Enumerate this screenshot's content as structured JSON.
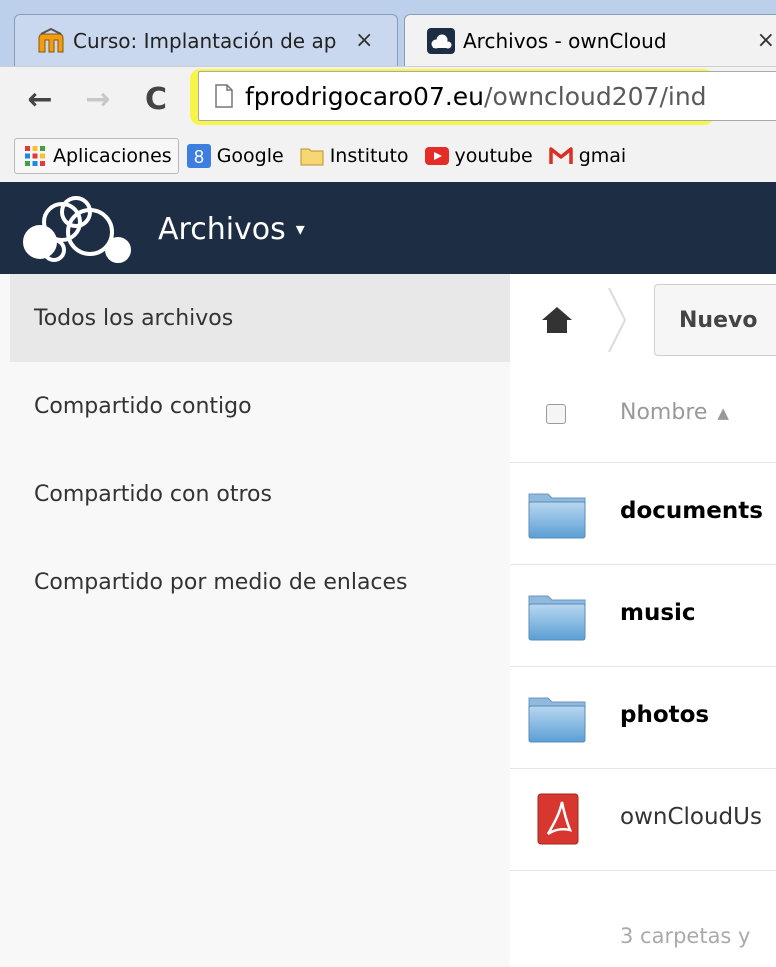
{
  "browser": {
    "tabs": [
      {
        "title": "Curso: Implantación de ap",
        "favicon": "moodle-icon",
        "active": false
      },
      {
        "title": "Archivos - ownCloud",
        "favicon": "owncloud-icon",
        "active": true
      }
    ],
    "tab_close_glyph": "×",
    "nav": {
      "back_glyph": "←",
      "forward_glyph": "→",
      "reload_glyph": "C"
    },
    "url": {
      "domain": "fprodrigocaro07.eu",
      "path": "/owncloud207/ind"
    },
    "highlight_color": "#f7f53b",
    "bookmarks": [
      {
        "label": "Aplicaciones",
        "icon": "apps-grid-icon"
      },
      {
        "label": "Google",
        "icon": "google-plus-icon"
      },
      {
        "label": "Instituto",
        "icon": "folder-icon"
      },
      {
        "label": "youtube",
        "icon": "youtube-icon"
      },
      {
        "label": "gmai",
        "icon": "gmail-icon"
      }
    ]
  },
  "header": {
    "app_name": "Archivos",
    "caret": "▾",
    "background": "#1d2d44"
  },
  "sidebar": {
    "items": [
      {
        "label": "Todos los archivos",
        "active": true
      },
      {
        "label": "Compartido contigo",
        "active": false
      },
      {
        "label": "Compartido con otros",
        "active": false
      },
      {
        "label": "Compartido por medio de enlaces",
        "active": false
      }
    ]
  },
  "main": {
    "new_button": "Nuevo",
    "column_name": "Nombre",
    "sort_glyph": "▲",
    "files": [
      {
        "name": "documents",
        "type": "folder"
      },
      {
        "name": "music",
        "type": "folder"
      },
      {
        "name": "photos",
        "type": "folder"
      },
      {
        "name": "ownCloudUs",
        "type": "pdf"
      }
    ],
    "summary": "3 carpetas y"
  }
}
